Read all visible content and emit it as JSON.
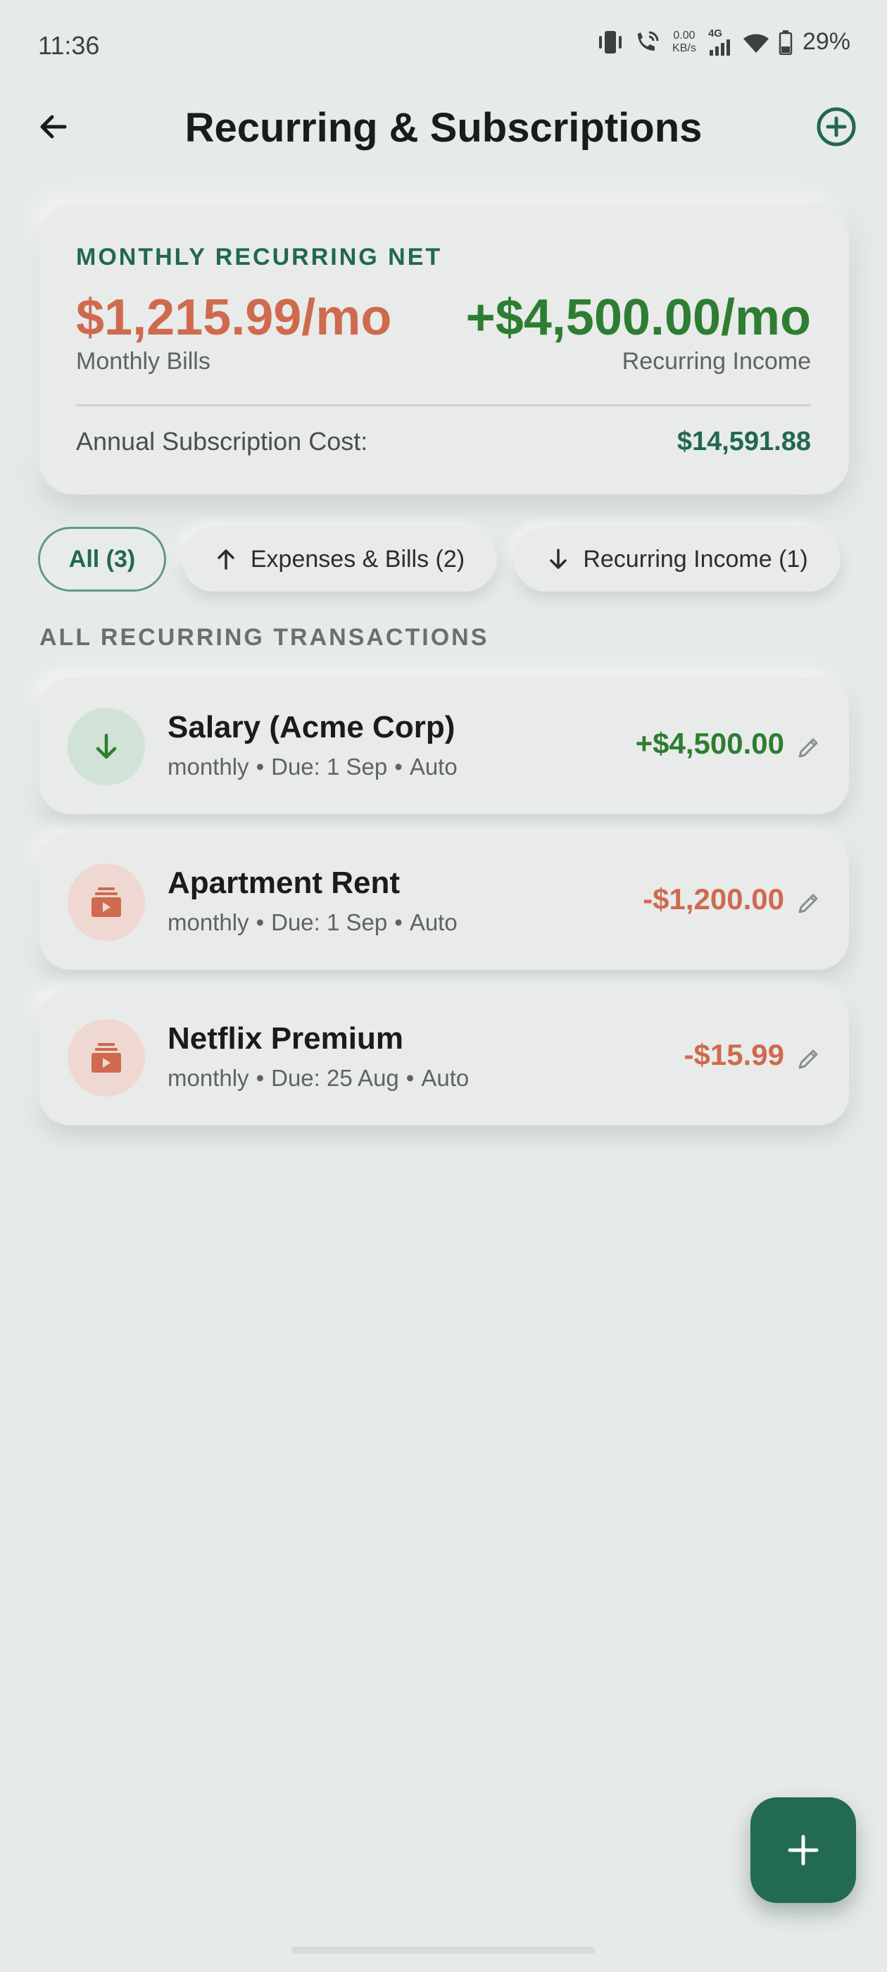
{
  "status_bar": {
    "time": "11:36",
    "net_speed_value": "0.00",
    "net_speed_unit": "KB/s",
    "network_type": "4G",
    "battery": "29%"
  },
  "header": {
    "title": "Recurring & Subscriptions",
    "back_icon": "arrow-left-icon",
    "add_icon": "plus-circle-icon"
  },
  "summary": {
    "label": "MONTHLY RECURRING NET",
    "bills_amount": "$1,215.99/mo",
    "bills_caption": "Monthly Bills",
    "income_amount": "+$4,500.00/mo",
    "income_caption": "Recurring Income",
    "annual_label": "Annual Subscription Cost:",
    "annual_value": "$14,591.88"
  },
  "filters": [
    {
      "label": "All (3)",
      "selected": true
    },
    {
      "label": "Expenses & Bills (2)",
      "icon": "arrow-up-icon"
    },
    {
      "label": "Recurring Income (1)",
      "icon": "arrow-down-icon"
    }
  ],
  "section_title": "ALL RECURRING TRANSACTIONS",
  "transactions": [
    {
      "name": "Salary (Acme Corp)",
      "frequency": "monthly",
      "due": "Due: 1 Sep",
      "mode": "Auto",
      "amount": "+$4,500.00",
      "type": "income",
      "icon": "arrow-down-icon"
    },
    {
      "name": "Apartment Rent",
      "frequency": "monthly",
      "due": "Due: 1 Sep",
      "mode": "Auto",
      "amount": "-$1,200.00",
      "type": "expense",
      "icon": "subscriptions-icon"
    },
    {
      "name": "Netflix Premium",
      "frequency": "monthly",
      "due": "Due: 25 Aug",
      "mode": "Auto",
      "amount": "-$15.99",
      "type": "expense",
      "icon": "subscriptions-icon"
    }
  ],
  "colors": {
    "background": "#e7ebe8",
    "accent_green": "#21684f",
    "income_green": "#2e7d32",
    "expense_orange": "#cf6a4e",
    "fab": "#226b52"
  }
}
